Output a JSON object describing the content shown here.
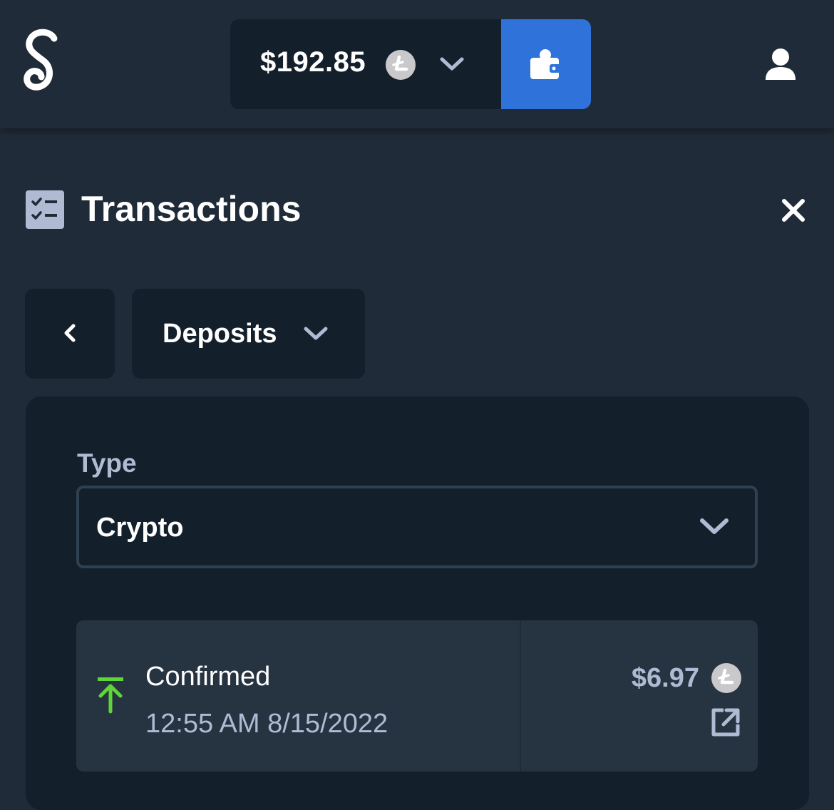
{
  "header": {
    "balance": "$192.85",
    "currency_icon": "litecoin-icon",
    "wallet_icon": "wallet-icon",
    "user_icon": "user-icon",
    "colors": {
      "background": "#1f2b38",
      "accent": "#2f73da"
    }
  },
  "page": {
    "title": "Transactions",
    "title_icon": "checklist-icon",
    "close_icon": "close-icon"
  },
  "filter": {
    "back_icon": "chevron-left-icon",
    "selected": "Deposits"
  },
  "type_select": {
    "label": "Type",
    "value": "Crypto"
  },
  "transactions": [
    {
      "status": "Confirmed",
      "datetime": "12:55 AM 8/15/2022",
      "amount": "$6.97",
      "direction_icon": "deposit-arrow-icon",
      "direction_color": "#5fd637",
      "link_icon": "external-link-icon"
    }
  ]
}
